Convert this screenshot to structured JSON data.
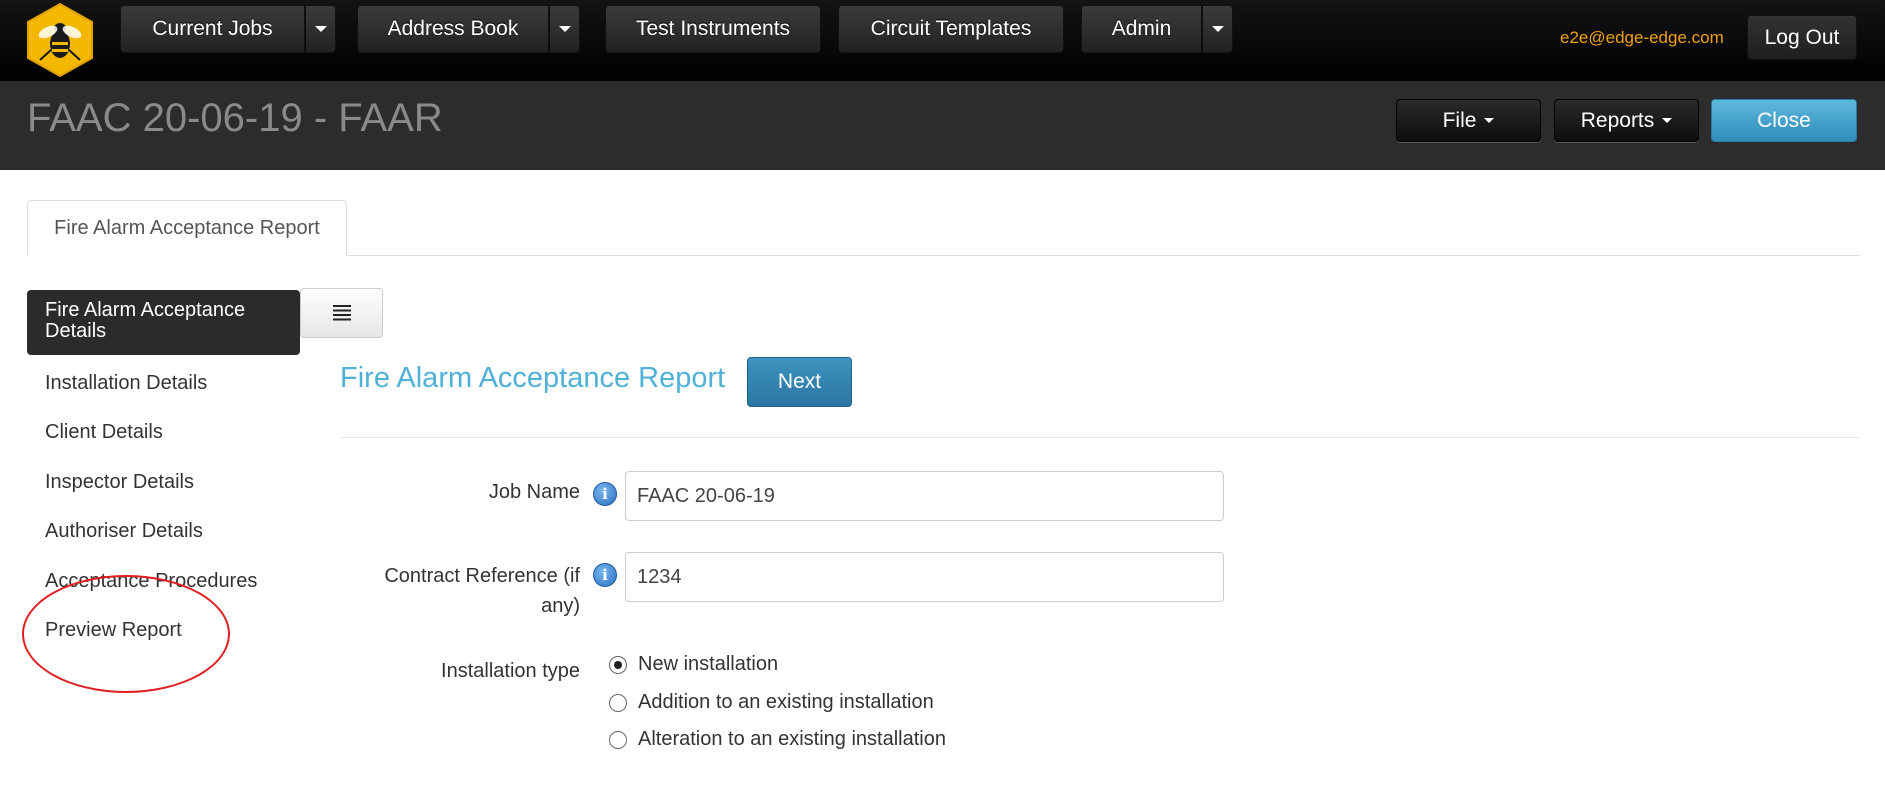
{
  "nav": {
    "current_jobs": "Current Jobs",
    "address_book": "Address Book",
    "test_instruments": "Test Instruments",
    "circuit_templates": "Circuit Templates",
    "admin": "Admin",
    "user_email": "e2e@edge-edge.com",
    "logout": "Log Out"
  },
  "header": {
    "title": "FAAC 20-06-19 - FAAR",
    "file": "File",
    "reports": "Reports",
    "close": "Close"
  },
  "tab": {
    "label": "Fire Alarm Acceptance Report"
  },
  "sidebar": {
    "active": "Fire Alarm Acceptance Details",
    "items": [
      "Installation Details",
      "Client Details",
      "Inspector Details",
      "Authoriser Details",
      "Acceptance Procedures",
      "Preview Report"
    ]
  },
  "form": {
    "title": "Fire Alarm Acceptance Report",
    "next": "Next",
    "job_name_label": "Job Name",
    "job_name_value": "FAAC 20-06-19",
    "contract_label_1": "Contract Reference (if",
    "contract_label_2": "any)",
    "contract_value": "1234",
    "installation_type_label": "Installation type",
    "installation_options": [
      "New installation",
      "Addition to an existing installation",
      "Alteration to an existing installation"
    ],
    "installation_selected": 0
  },
  "colors": {
    "accent_blue": "#4fb1d8",
    "email_orange": "#f0a012",
    "annotation_red": "#e02020"
  }
}
